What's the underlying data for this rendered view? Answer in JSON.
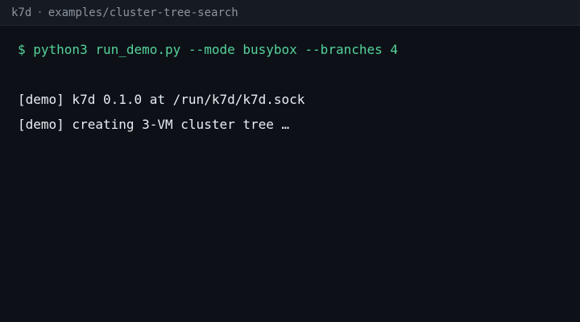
{
  "window": {
    "title_app": "k7d",
    "title_separator": "·",
    "title_path": "examples/cluster-tree-search"
  },
  "terminal": {
    "prompt_line": "$ python3 run_demo.py --mode busybox --branches 4",
    "lines": [
      "[demo] k7d 0.1.0 at /run/k7d/k7d.sock",
      "[demo] creating 3-VM cluster tree …"
    ]
  },
  "colors": {
    "background": "#0d1117",
    "titlebar": "#161b22",
    "command": "#56d29a",
    "output": "#e6edf3",
    "title_text": "#8b949e"
  }
}
